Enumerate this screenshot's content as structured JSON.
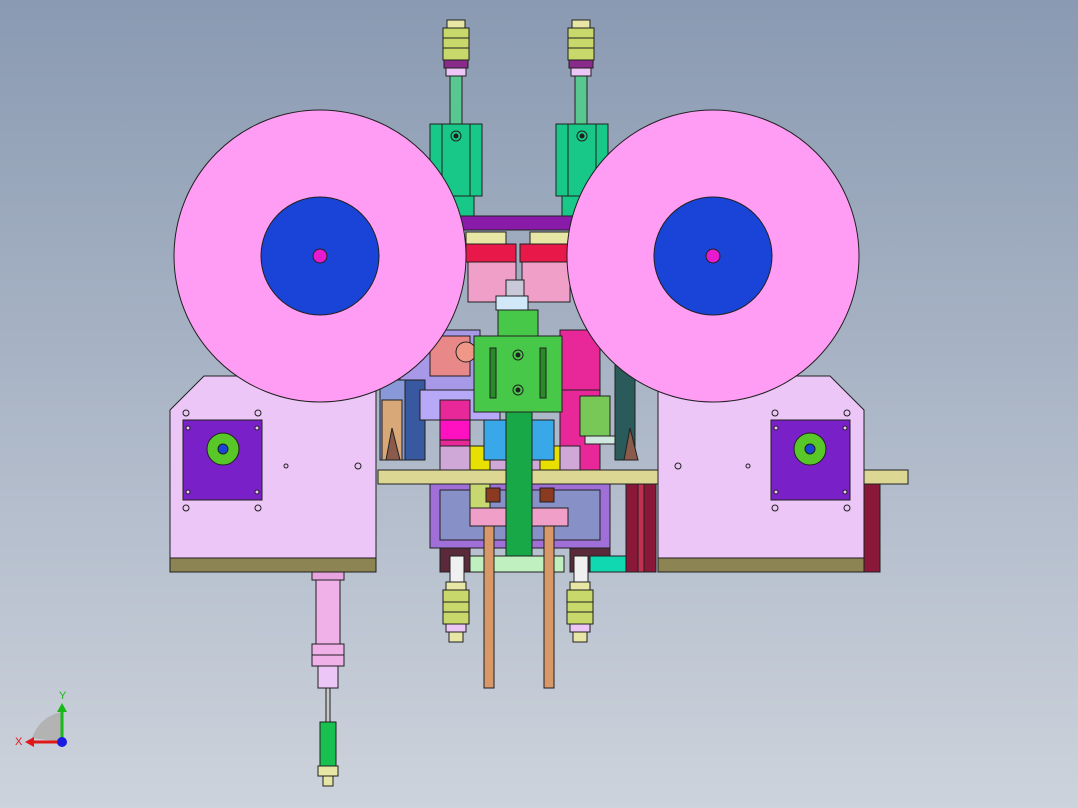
{
  "viewport": {
    "background_top": "#8a9ab2",
    "background_bottom": "#cdd3dc"
  },
  "triad": {
    "x_label": "X",
    "y_label": "Y",
    "x_color": "#e01818",
    "y_color": "#18b818",
    "z_color": "#1a1ae0"
  },
  "colors": {
    "reel_outer": "#ff9cf4",
    "reel_hub": "#1a44d8",
    "reel_center": "#e81ad0",
    "housing": "#ecc6f6",
    "housing_base": "#8c8452",
    "motor_plate": "#7a20c8",
    "motor_shaft": "#58c828",
    "cylinder_body": "#18c888",
    "rod_tan": "#e8e6a4",
    "center_block": "#48c848",
    "pin_copper": "#d89868",
    "post_dark_red": "#8a1830",
    "tray": "#dcd894"
  }
}
